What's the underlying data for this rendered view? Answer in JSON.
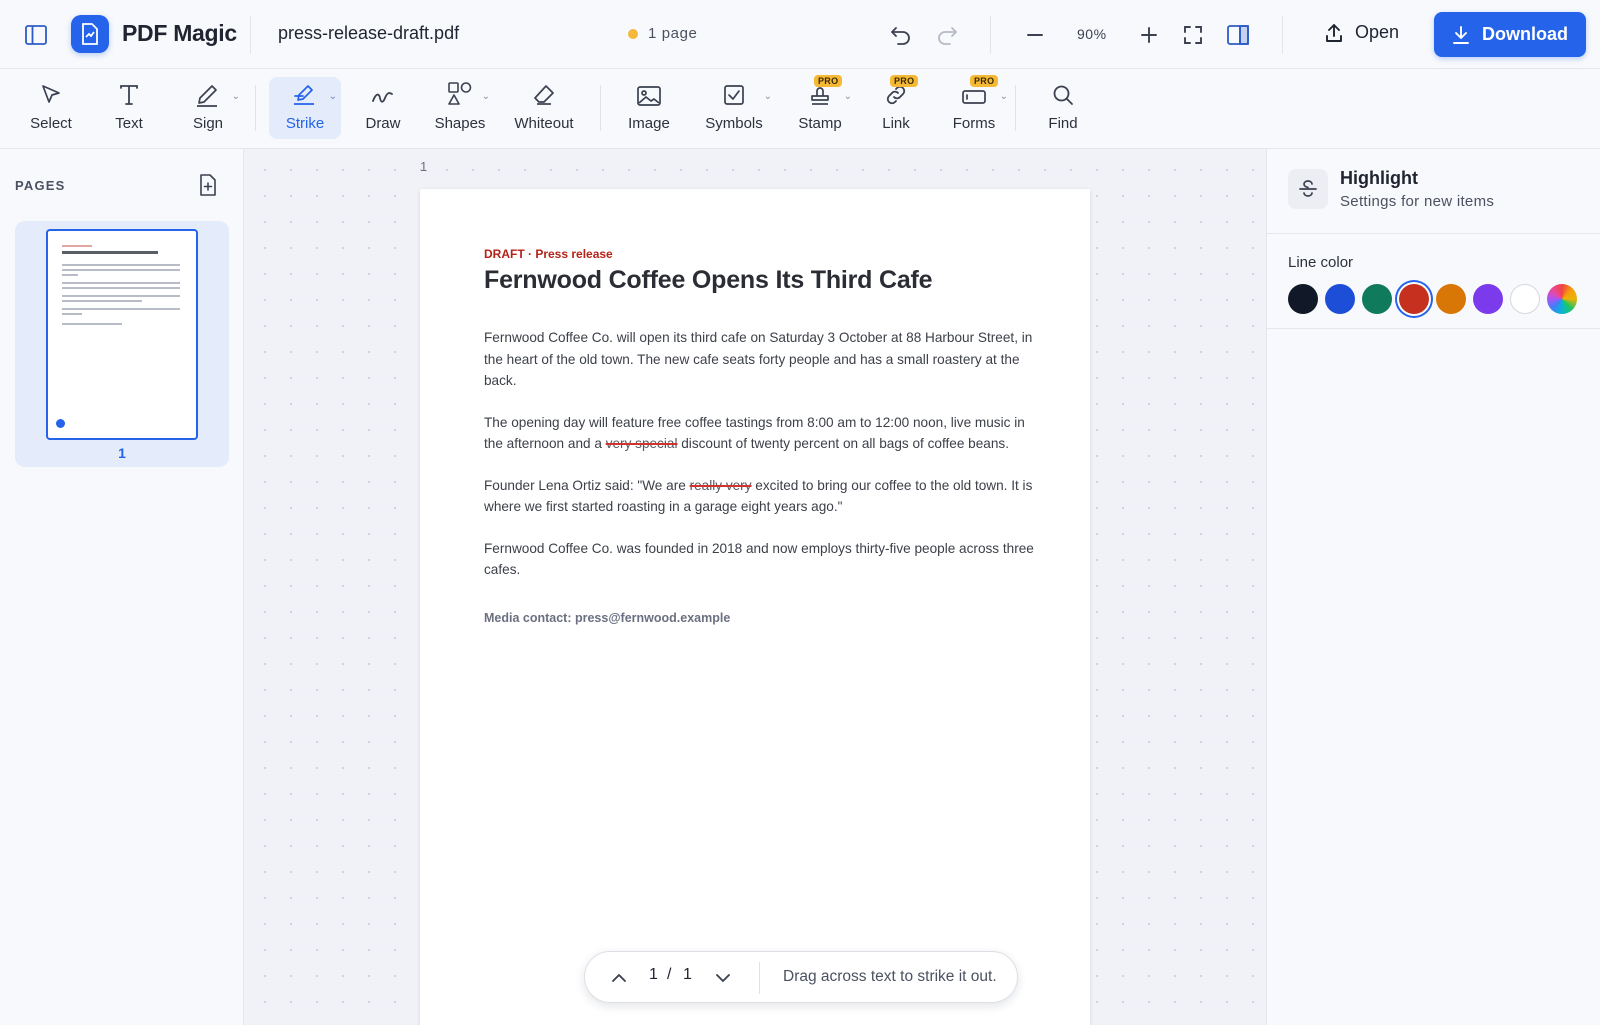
{
  "app": {
    "name": "PDF Magic"
  },
  "file": {
    "name": "press-release-draft.pdf",
    "page_count_label": "1 page"
  },
  "zoom": {
    "value": "90%"
  },
  "header": {
    "open_label": "Open",
    "download_label": "Download"
  },
  "tools": [
    {
      "id": "select",
      "label": "Select",
      "icon": "cursor-icon"
    },
    {
      "id": "text",
      "label": "Text",
      "icon": "text-icon"
    },
    {
      "id": "sign",
      "label": "Sign",
      "icon": "pen-icon",
      "has_menu": true
    },
    {
      "id": "strike",
      "label": "Strike",
      "icon": "strikethrough-icon",
      "has_menu": true,
      "active": true
    },
    {
      "id": "draw",
      "label": "Draw",
      "icon": "squiggle-icon"
    },
    {
      "id": "shapes",
      "label": "Shapes",
      "icon": "shapes-icon",
      "has_menu": true
    },
    {
      "id": "whiteout",
      "label": "Whiteout",
      "icon": "eraser-icon"
    },
    {
      "id": "image",
      "label": "Image",
      "icon": "image-icon"
    },
    {
      "id": "symbols",
      "label": "Symbols",
      "icon": "checkbox-icon",
      "has_menu": true
    },
    {
      "id": "stamp",
      "label": "Stamp",
      "icon": "stamp-icon",
      "has_menu": true,
      "pro": "PRO"
    },
    {
      "id": "link",
      "label": "Link",
      "icon": "link-icon",
      "pro": "PRO"
    },
    {
      "id": "forms",
      "label": "Forms",
      "icon": "form-icon",
      "has_menu": true,
      "pro": "PRO"
    },
    {
      "id": "find",
      "label": "Find",
      "icon": "search-icon"
    }
  ],
  "sidebar": {
    "title": "PAGES",
    "thumbnails": [
      {
        "number": "1"
      }
    ]
  },
  "canvas": {
    "page_label": "1"
  },
  "document": {
    "kicker": "DRAFT · Press release",
    "title": "Fernwood Coffee Opens Its Third Cafe",
    "p1": "Fernwood Coffee Co. will open its third cafe on Saturday 3 October at 88 Harbour Street, in the heart of the old town. The new cafe seats forty people and has a small roastery at the back.",
    "p2_a": "The opening day will feature free coffee tastings from 8:00 am to 12:00 noon, live music in the afternoon and a ",
    "p2_strike": "very special",
    "p2_b": " discount of twenty percent on all bags of coffee beans.",
    "p3_a": "Founder Lena Ortiz said: \"We are ",
    "p3_strike": "really very",
    "p3_b": " excited to bring our coffee to the old town. It is where we first started roasting in a garage eight years ago.\"",
    "p4": "Fernwood Coffee Co. was founded in 2018 and now employs thirty-five people across three cafes.",
    "contact": "Media contact: press@fernwood.example"
  },
  "pager": {
    "current": "1",
    "separator": "/",
    "total": "1",
    "hint": "Drag across text to strike it out."
  },
  "panel": {
    "title": "Highlight",
    "subtitle": "Settings for new items",
    "line_color_label": "Line color",
    "colors": [
      "#111827",
      "#1d4ed8",
      "#0f7a5c",
      "#c6311f",
      "#d97706",
      "#7c3aed",
      "#ffffff",
      "rainbow"
    ],
    "selected_color": "#c6311f"
  }
}
